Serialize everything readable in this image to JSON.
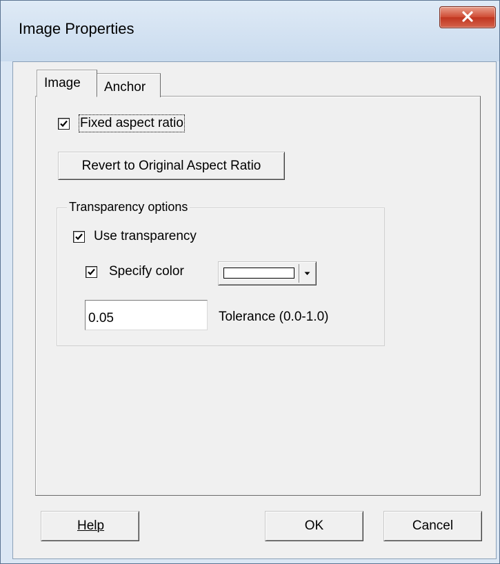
{
  "window": {
    "title": "Image Properties",
    "close_icon": "close-x-icon"
  },
  "tabs": [
    {
      "label": "Image",
      "active": true
    },
    {
      "label": "Anchor",
      "active": false
    }
  ],
  "image_tab": {
    "fixed_aspect_ratio": {
      "label": "Fixed aspect ratio",
      "checked": true
    },
    "revert_button": "Revert to Original Aspect Ratio",
    "transparency_group": {
      "legend": "Transparency options",
      "use_transparency": {
        "label": "Use transparency",
        "checked": true
      },
      "specify_color": {
        "label": "Specify color",
        "checked": true
      },
      "color_value": "#ffffff",
      "tolerance_value": "0.05",
      "tolerance_label": "Tolerance (0.0-1.0)"
    }
  },
  "footer": {
    "help_label": "Help",
    "ok_label": "OK",
    "cancel_label": "Cancel"
  }
}
